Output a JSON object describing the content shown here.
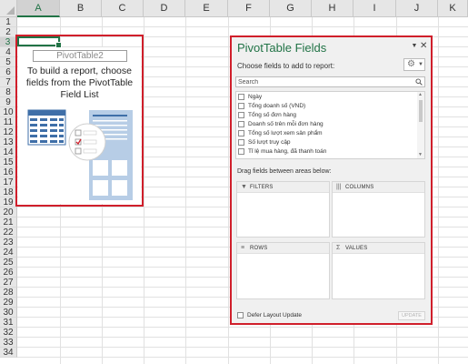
{
  "sheet": {
    "columns": [
      "A",
      "B",
      "C",
      "D",
      "E",
      "F",
      "G",
      "H",
      "I",
      "J",
      "K"
    ],
    "rows": [
      "1",
      "2",
      "3",
      "4",
      "5",
      "6",
      "7",
      "8",
      "9",
      "10",
      "11",
      "12",
      "13",
      "14",
      "15",
      "16",
      "17",
      "18",
      "19",
      "20",
      "21",
      "22",
      "23",
      "24",
      "25",
      "26",
      "27",
      "28",
      "29",
      "30",
      "31",
      "32",
      "33",
      "34"
    ],
    "active_column": "A",
    "active_row": "3"
  },
  "pivot_placeholder": {
    "name": "PivotTable2",
    "instructions": "To build a report, choose fields from the PivotTable Field List"
  },
  "field_list_pane": {
    "title": "PivotTable Fields",
    "choose_label": "Choose fields to add to report:",
    "search_placeholder": "Search",
    "fields": [
      "Ngày",
      "Tổng doanh số (VND)",
      "Tổng số đơn hàng",
      "Doanh số trên mỗi đơn hàng",
      "Tổng số lượt xem sản phẩm",
      "Số lượt truy cập",
      "Tỉ lệ mua hàng, đã thanh toán"
    ],
    "drag_label": "Drag fields between areas below:",
    "areas": {
      "filters": "FILTERS",
      "columns": "COLUMNS",
      "rows": "ROWS",
      "values": "VALUES"
    },
    "defer_label": "Defer Layout Update",
    "update_label": "UPDATE"
  },
  "colors": {
    "accent_green": "#217346",
    "highlight_red": "#d01f2b",
    "pane_background": "#f0f0f0"
  },
  "icons": {
    "pane_menu": "dropdown-triangle-icon",
    "pane_close": "close-icon",
    "tools": "gear-icon",
    "search": "search-icon",
    "filters": "filter-funnel-icon",
    "columns": "columns-icon",
    "rows": "rows-icon",
    "values": "sigma-icon"
  }
}
